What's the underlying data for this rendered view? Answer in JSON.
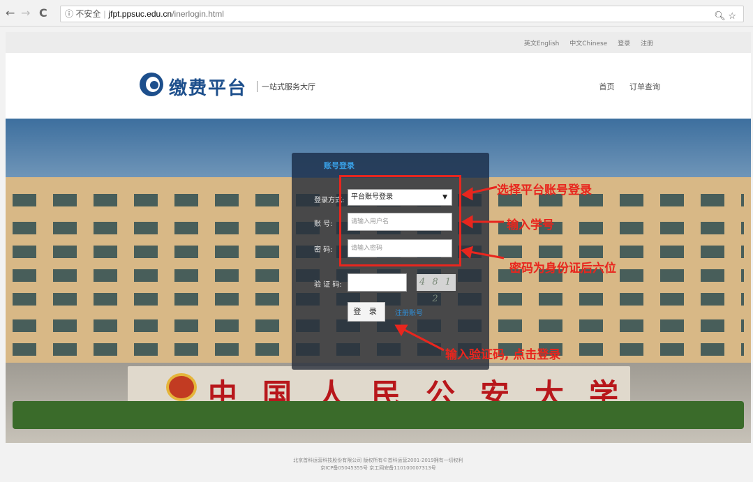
{
  "browser": {
    "back": "←",
    "forward": "→",
    "reload": "C",
    "security": "ⓘ 不安全",
    "host": "jfpt.ppsuc.edu.cn",
    "path": "/inerlogin.html",
    "zoom_icon": "magnifier-icon",
    "star_icon": "star-icon"
  },
  "toplinks": [
    "英文English",
    "中文Chinese",
    "登录",
    "注册"
  ],
  "header": {
    "title": "缴费平台",
    "subtitle": "一站式服务大厅",
    "nav": [
      "首页",
      "订单查询"
    ]
  },
  "hero": {
    "school_name": "中国人民公安大学"
  },
  "login": {
    "tab": "账号登录",
    "method_label": "登录方式:",
    "method_value": "平台账号登录",
    "username_label": "账    号:",
    "username_placeholder": "请输入用户名",
    "password_label": "密    码:",
    "password_placeholder": "请输入密码",
    "captcha_label": "验 证 码:",
    "captcha_text": "4 8 1 2",
    "submit": "登 录",
    "register": "注册账号"
  },
  "annotations": {
    "select_method": "选择平台账号登录",
    "student_id": "输入学号",
    "password_hint": "密码为身份证后六位",
    "captcha_hint": "输入验证码, 点击登录",
    "color": "#e8261e"
  },
  "footer": {
    "line1": "北京首科运营科技股份有限公司 版权所有©首科运营2001-2019拥有一切权利",
    "line2": "京ICP备05045355号 京工网安备110100007313号"
  }
}
